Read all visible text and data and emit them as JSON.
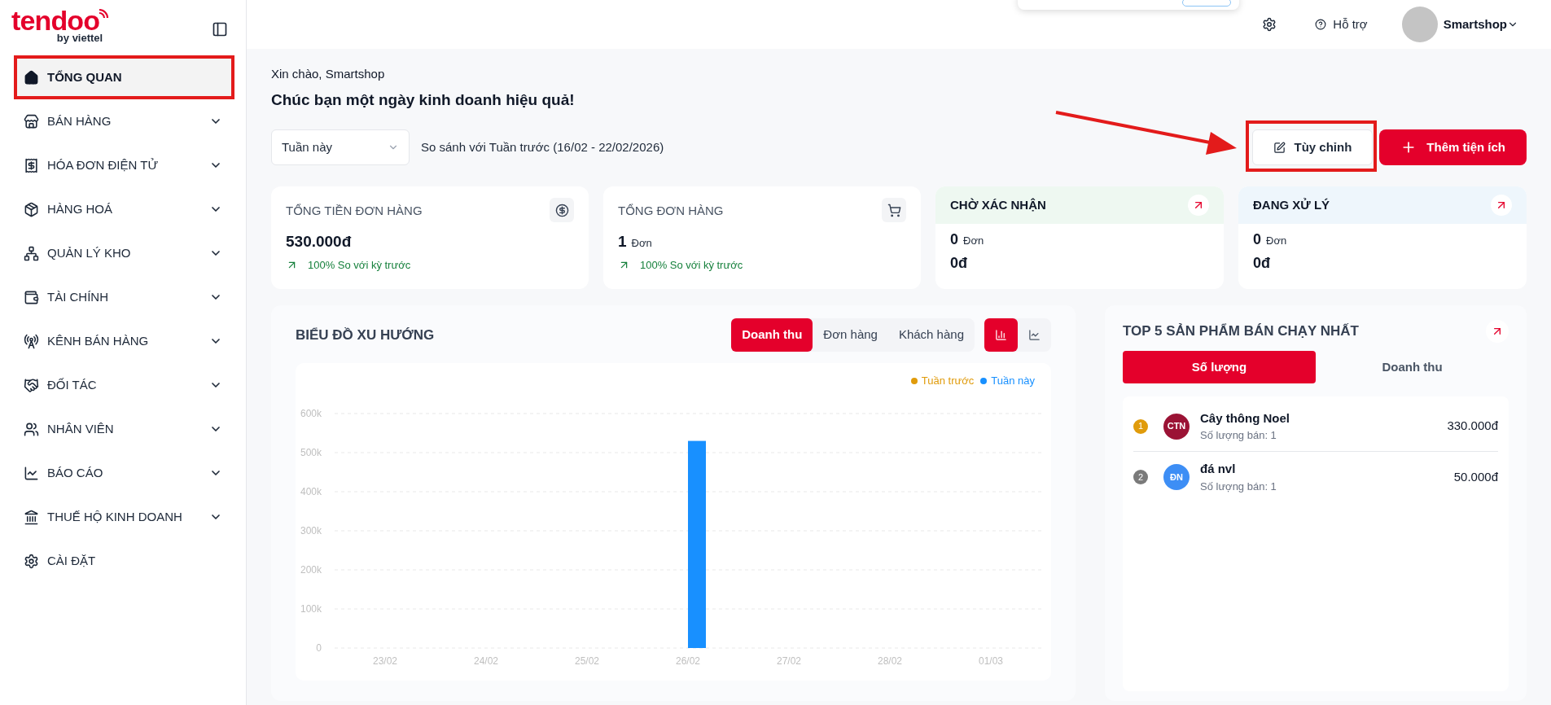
{
  "brand": {
    "name": "tendoo",
    "tagline": "by viettel"
  },
  "sidebar": {
    "items": [
      {
        "label": "TỔNG QUAN",
        "selected": true,
        "expandable": false
      },
      {
        "label": "BÁN HÀNG",
        "selected": false,
        "expandable": true
      },
      {
        "label": "HÓA ĐƠN ĐIỆN TỬ",
        "selected": false,
        "expandable": true
      },
      {
        "label": "HÀNG HOÁ",
        "selected": false,
        "expandable": true
      },
      {
        "label": "QUẢN LÝ KHO",
        "selected": false,
        "expandable": true
      },
      {
        "label": "TÀI CHÍNH",
        "selected": false,
        "expandable": true
      },
      {
        "label": "KÊNH BÁN HÀNG",
        "selected": false,
        "expandable": true
      },
      {
        "label": "ĐỐI TÁC",
        "selected": false,
        "expandable": true
      },
      {
        "label": "NHÂN VIÊN",
        "selected": false,
        "expandable": true
      },
      {
        "label": "BÁO CÁO",
        "selected": false,
        "expandable": true
      },
      {
        "label": "THUẾ HỘ KINH DOANH",
        "selected": false,
        "expandable": true
      },
      {
        "label": "CÀI ĐẶT",
        "selected": false,
        "expandable": false
      }
    ]
  },
  "header": {
    "help": "Hỗ trợ",
    "user": "Smartshop"
  },
  "greeting": "Xin chào, Smartshop",
  "headline": "Chúc bạn một ngày kinh doanh hiệu quả!",
  "period": {
    "value": "Tuần này",
    "compare": "So sánh với Tuần trước (16/02 - 22/02/2026)"
  },
  "actions": {
    "customize": "Tùy chỉnh",
    "add": "Thêm tiện ích"
  },
  "stats": [
    {
      "kind": "metric",
      "title": "TỔNG TIỀN ĐƠN HÀNG",
      "value": "530.000đ",
      "trend": "100% So với kỳ trước"
    },
    {
      "kind": "metric",
      "title": "TỔNG ĐƠN HÀNG",
      "value": "1",
      "unit": "Đơn",
      "trend": "100% So với kỳ trước"
    },
    {
      "kind": "status",
      "title": "CHỜ XÁC NHẬN",
      "value": "0",
      "unit": "Đơn",
      "amount": "0đ",
      "color": "#eef8f1"
    },
    {
      "kind": "status",
      "title": "ĐANG XỬ LÝ",
      "value": "0",
      "unit": "Đơn",
      "amount": "0đ",
      "color": "#eef6fc"
    }
  ],
  "trend_chart": {
    "title": "BIỂU ĐỒ XU HƯỚNG",
    "tabs": [
      {
        "label": "Doanh thu",
        "selected": true
      },
      {
        "label": "Đơn hàng",
        "selected": false
      },
      {
        "label": "Khách hàng",
        "selected": false
      }
    ],
    "views": [
      {
        "kind": "bar",
        "selected": true
      },
      {
        "kind": "line",
        "selected": false
      }
    ],
    "chart_data": {
      "type": "bar",
      "categories": [
        "23/02",
        "24/02",
        "25/02",
        "26/02",
        "27/02",
        "28/02",
        "01/03"
      ],
      "series": [
        {
          "name": "Tuần trước",
          "color": "#e09b0b",
          "values": [
            0,
            0,
            0,
            0,
            0,
            0,
            0
          ]
        },
        {
          "name": "Tuần này",
          "color": "#1890ff",
          "values": [
            0,
            0,
            0,
            530000,
            0,
            0,
            0
          ]
        }
      ],
      "ylim": [
        0,
        600000
      ],
      "grid": true,
      "yticks": [
        {
          "value": 0,
          "label": "0"
        },
        {
          "value": 100000,
          "label": "100k"
        },
        {
          "value": 200000,
          "label": "200k"
        },
        {
          "value": 300000,
          "label": "300k"
        },
        {
          "value": 400000,
          "label": "400k"
        },
        {
          "value": 500000,
          "label": "500k"
        },
        {
          "value": 600000,
          "label": "600k"
        }
      ]
    }
  },
  "top_products": {
    "title": "TOP 5 SẢN PHẨM BÁN CHẠY NHẤT",
    "tabs": [
      {
        "label": "Số lượng",
        "selected": true
      },
      {
        "label": "Doanh thu",
        "selected": false
      }
    ],
    "items": [
      {
        "rank": {
          "text": "1",
          "color": "#e09b0b"
        },
        "avatar": {
          "initials": "CTN",
          "color": "#9b1335"
        },
        "name": "Cây thông Noel",
        "sold": "Số lượng bán: 1",
        "amount": "330.000đ"
      },
      {
        "rank": {
          "text": "2",
          "color": "#7a7a7a"
        },
        "avatar": {
          "initials": "ĐN",
          "color": "#3d8ef5"
        },
        "name": "đá nvl",
        "sold": "Số lượng bán: 1",
        "amount": "50.000đ"
      }
    ]
  }
}
